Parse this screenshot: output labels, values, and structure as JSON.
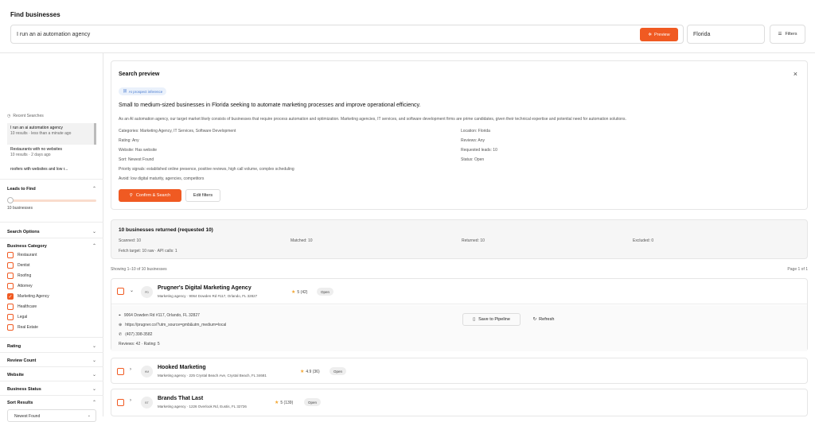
{
  "header": {
    "title": "Find businesses",
    "search_value": "I run an ai automation agency",
    "preview_label": "Preview",
    "location_value": "Florida",
    "filters_label": "Filters"
  },
  "sidebar": {
    "recent_title": "Recent Searches",
    "recent": [
      {
        "title": "I run an ai automation agency",
        "sub": "10 results · less than a minute ago"
      },
      {
        "title": "Restaurants with no websites",
        "sub": "10 results · 2 days ago"
      },
      {
        "title": "roofers with websites and low r...",
        "sub": ""
      }
    ],
    "leads_title": "Leads to Find",
    "leads_value": "10 businesses",
    "leads_fraction": 0.0,
    "search_options": "Search Options",
    "category_title": "Business Category",
    "categories": [
      {
        "label": "Restaurant",
        "checked": false
      },
      {
        "label": "Dentist",
        "checked": false
      },
      {
        "label": "Roofing",
        "checked": false
      },
      {
        "label": "Attorney",
        "checked": false
      },
      {
        "label": "Marketing Agency",
        "checked": true
      },
      {
        "label": "Healthcare",
        "checked": false
      },
      {
        "label": "Legal",
        "checked": false
      },
      {
        "label": "Real Estate",
        "checked": false
      }
    ],
    "rating": "Rating",
    "review_count": "Review Count",
    "website": "Website",
    "business_status": "Business Status",
    "sort_results": "Sort Results",
    "sort_value": "Newest Found"
  },
  "preview": {
    "title": "Search preview",
    "badge": "AI prospect inference",
    "headline": "Small to medium-sized businesses in Florida seeking to automate marketing processes and improve operational efficiency.",
    "description": "As an AI automation agency, our target market likely consists of businesses that require process automation and optimization. Marketing agencies, IT services, and software development firms are prime candidates, given their technical expertise and potential need for automation solutions.",
    "left": [
      "Categories: Marketing Agency, IT Services, Software Development",
      "Rating: Any",
      "Website: Has website",
      "Sort: Newest Found",
      "Priority signals: established online presence, positive reviews, high call volume, complex scheduling",
      "Avoid: low digital maturity, agencies, competitors"
    ],
    "right": [
      "Location: Florida",
      "Reviews: Any",
      "Requested leads: 10",
      "Status: Open"
    ],
    "confirm_label": "Confirm & Search",
    "edit_label": "Edit filters"
  },
  "stats": {
    "title": "10 businesses returned (requested 10)",
    "scanned": "Scanned: 10",
    "matched": "Matched: 10",
    "returned": "Returned: 10",
    "excluded": "Excluded: 0",
    "fetch": "Fetch target: 10 raw · API calls: 1"
  },
  "results": {
    "showing": "Showing 1–10 of 10 businesses",
    "page": "Page 1 of 1",
    "items": [
      {
        "initials": "PD",
        "name": "Prugner's Digital Marketing Agency",
        "sub": "Marketing agency · 9064 Dowden Rd #117, Orlando, FL 32827",
        "rating": "5 (42)",
        "status": "Open",
        "address": "9064 Dowden Rd #117, Orlando, FL 32827",
        "url": "https://prugner.co/?utm_source=gmb&utm_medium=local",
        "phone": "(407) 398-3582",
        "reviews": "Reviews: 42 · Rating: 5",
        "pipeline_label": "Save to Pipeline",
        "refresh_label": "Refresh"
      },
      {
        "initials": "HM",
        "name": "Hooked Marketing",
        "sub": "Marketing agency · 225 Crystal Beach Ave, Crystal Beach, FL 34681",
        "rating": "4.9 (36)",
        "status": "Open"
      },
      {
        "initials": "BT",
        "name": "Brands That Last",
        "sub": "Marketing agency · 1226 Overlook Rd, Eustis, FL 32726",
        "rating": "5 (139)",
        "status": "Open"
      }
    ]
  },
  "colors": {
    "accent": "#f05a22",
    "star": "#f2a531",
    "ai_badge": "#4a7bd0"
  }
}
